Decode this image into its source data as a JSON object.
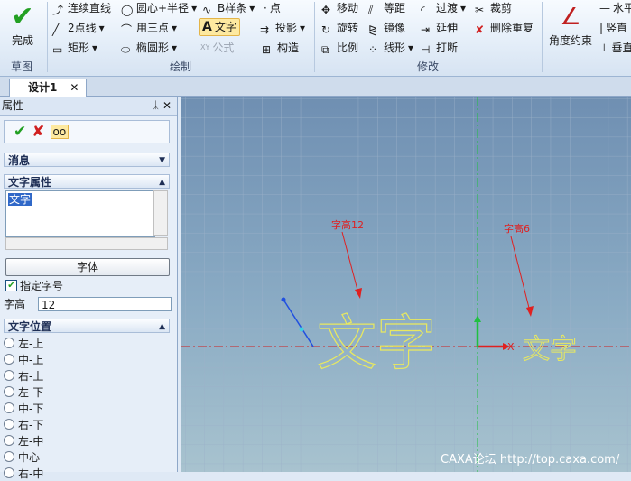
{
  "ribbon": {
    "done": "完成",
    "groups": {
      "sketch": "草图",
      "draw": "绘制",
      "modify": "修改"
    },
    "draw": {
      "continuous_line": "连续直线",
      "center_radius": "圆心+半径",
      "bspline": "B样条",
      "point": "点",
      "two_point_line": "2点线",
      "three_point": "用三点",
      "text": "文字",
      "projection": "投影",
      "rectangle": "矩形",
      "ellipse": "椭圆形",
      "formula": "公式",
      "construct": "构造"
    },
    "modify": {
      "move": "移动",
      "equidistant": "等距",
      "transition": "过渡",
      "trim": "裁剪",
      "rotate": "旋转",
      "mirror": "镜像",
      "extend": "延伸",
      "delete_dup": "删除重复",
      "scale": "比例",
      "linear": "线形",
      "break": "打断"
    },
    "constraint": {
      "angle": "角度约束",
      "horizontal": "水平",
      "vertical": "竖直",
      "perpendicular": "垂直"
    }
  },
  "tabs": [
    {
      "label": "设计1"
    }
  ],
  "panel": {
    "title": "属性",
    "sections": {
      "hint": "消息",
      "text_props": "文字属性",
      "text_pos": "文字位置"
    },
    "text_value": "文字",
    "font_button": "字体",
    "specify_size": "指定字号",
    "height_label": "字高",
    "height_value": "12",
    "positions": [
      "左-上",
      "中-上",
      "右-上",
      "左-下",
      "中-下",
      "右-下",
      "左-中",
      "中心",
      "右-中"
    ]
  },
  "canvas": {
    "annotations": [
      "字高12",
      "字高6"
    ],
    "big_text": "文字",
    "small_text": "文字",
    "axis_label": "X"
  },
  "watermark": "CAXA论坛 http://top.caxa.com/"
}
